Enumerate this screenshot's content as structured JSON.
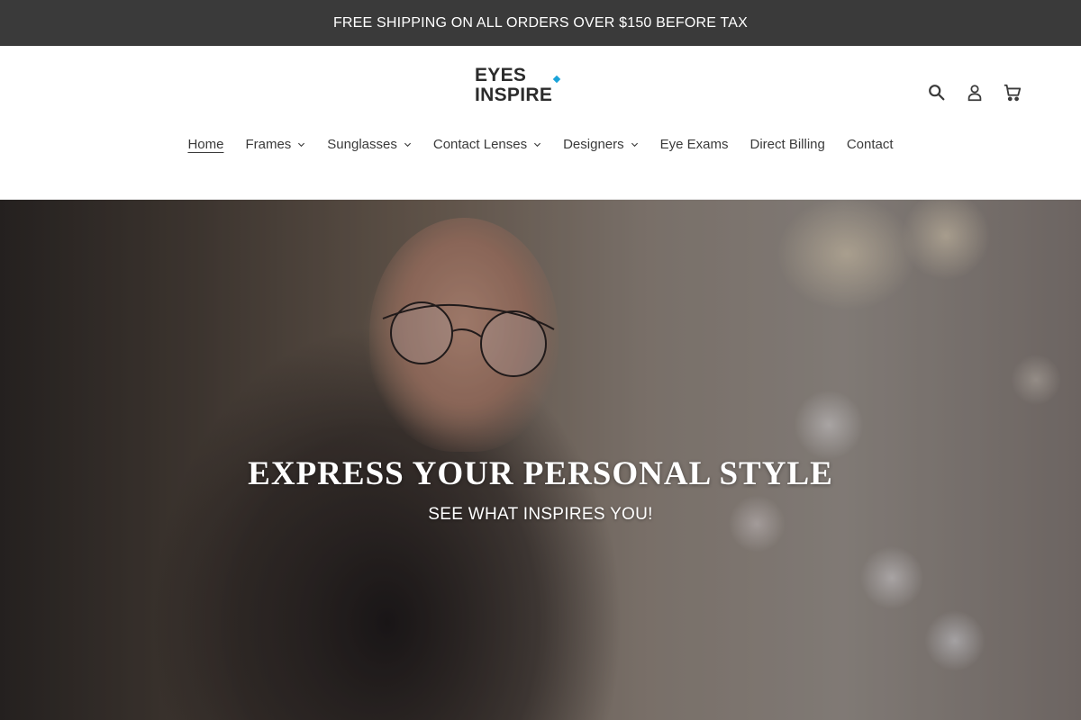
{
  "announcement": {
    "text": "FREE SHIPPING ON ALL ORDERS OVER $150 BEFORE TAX"
  },
  "header": {
    "logo_text": "EYES INSPIRE",
    "icons": [
      "search-icon",
      "account-icon",
      "cart-icon"
    ]
  },
  "nav": {
    "items": [
      {
        "label": "Home",
        "active": true,
        "has_dropdown": false
      },
      {
        "label": "Frames",
        "has_dropdown": true
      },
      {
        "label": "Sunglasses",
        "has_dropdown": true
      },
      {
        "label": "Contact Lenses",
        "has_dropdown": true
      },
      {
        "label": "Designers",
        "has_dropdown": true
      },
      {
        "label": "Eye Exams",
        "has_dropdown": false
      },
      {
        "label": "Direct Billing",
        "has_dropdown": false
      },
      {
        "label": "Contact",
        "has_dropdown": false
      }
    ]
  },
  "hero": {
    "title": "EXPRESS YOUR PERSONAL STYLE",
    "subtitle": "SEE WHAT INSPIRES YOU!"
  },
  "colors": {
    "announcement_bg": "#3a3a3a",
    "logo_accent": "#1aa3d9",
    "text": "#3a3a3a"
  }
}
